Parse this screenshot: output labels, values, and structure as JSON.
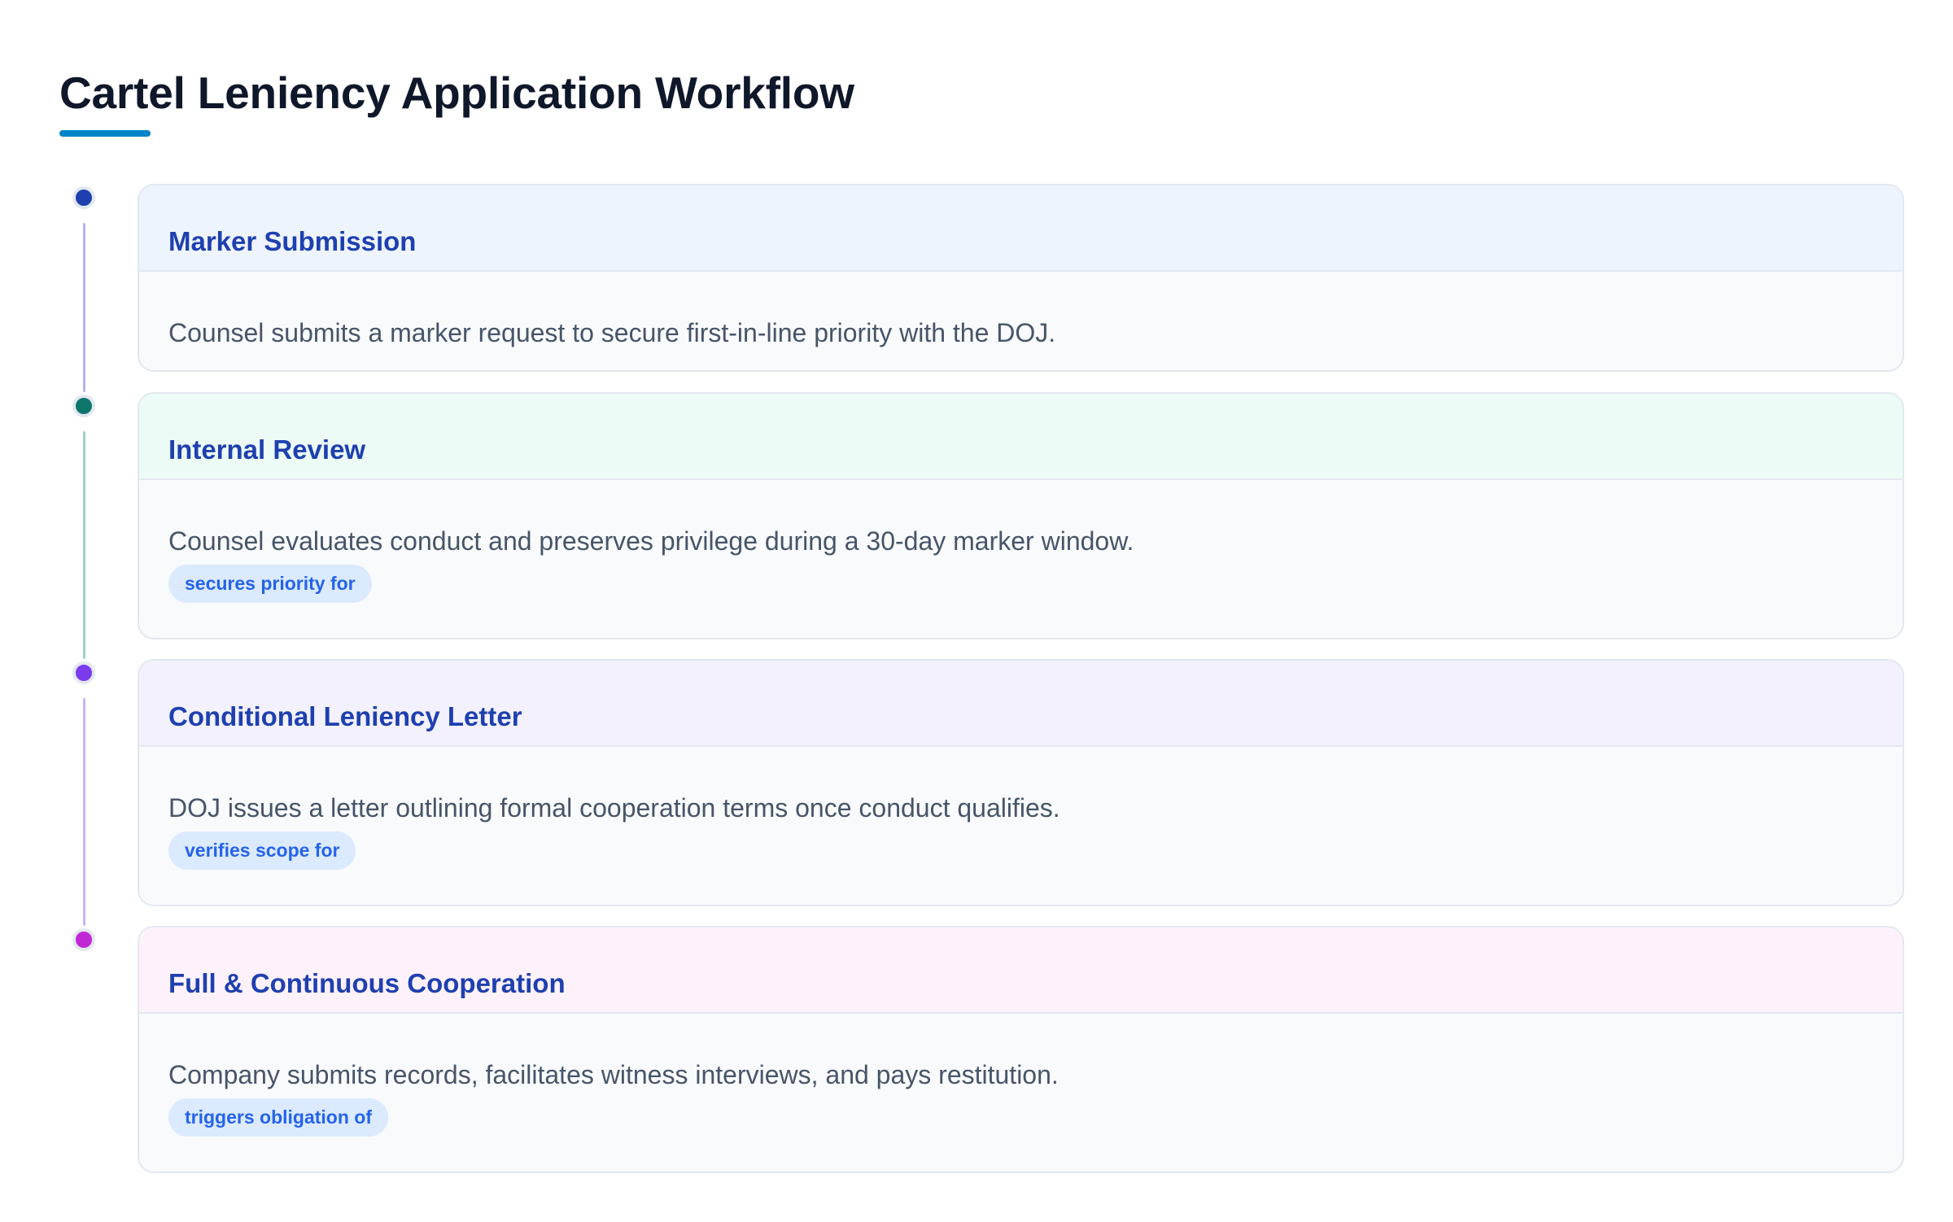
{
  "page": {
    "title": "Cartel Leniency Application Workflow"
  },
  "colors": {
    "accent": "#0284c7",
    "title_text": "#0f172a",
    "step_title": "#1e40af",
    "body_text": "#475569",
    "tag_background": "#dbeafe",
    "tag_text": "#2563eb"
  },
  "steps": [
    {
      "title": "Marker Submission",
      "description": "Counsel submits a marker request to secure first-in-line priority with the DOJ.",
      "tag": "",
      "dot_color": "#1e40af",
      "header_color": "#eef4fd"
    },
    {
      "title": "Internal Review",
      "description": "Counsel evaluates conduct and preserves privilege during a 30-day marker window.",
      "tag": "secures priority for",
      "dot_color": "#0f766e",
      "header_color": "#ecfbf6"
    },
    {
      "title": "Conditional Leniency Letter",
      "description": "DOJ issues a letter outlining formal cooperation terms once conduct qualifies.",
      "tag": "verifies scope for",
      "dot_color": "#7c3aed",
      "header_color": "#f2f1fd"
    },
    {
      "title": "Full & Continuous Cooperation",
      "description": "Company submits records, facilitates witness interviews, and pays restitution.",
      "tag": "triggers obligation of",
      "dot_color": "#c026d3",
      "header_color": "#fdf1fc"
    }
  ],
  "connectors": [
    {
      "color": "#b4b4ec"
    },
    {
      "color": "#9fcfc8"
    },
    {
      "color": "#cbb2f6"
    }
  ]
}
